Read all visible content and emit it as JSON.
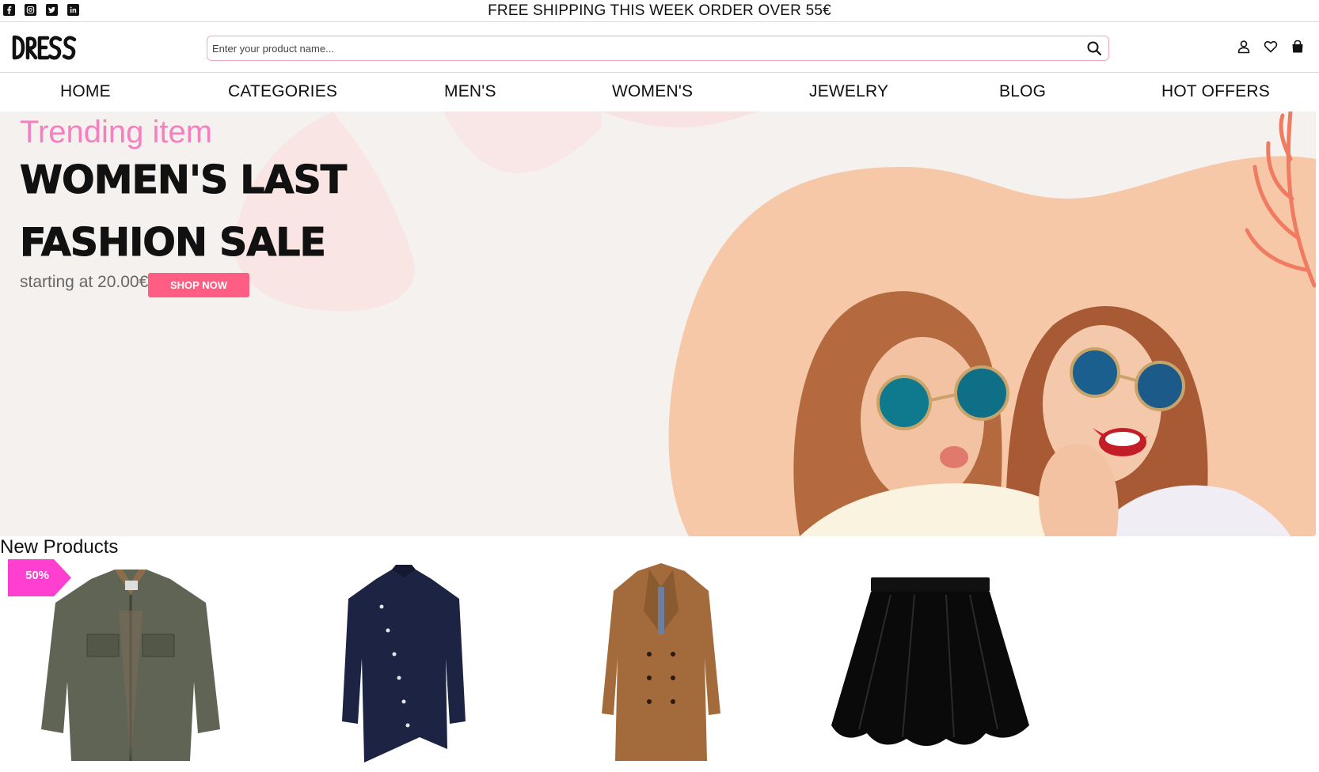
{
  "topbar": {
    "socials": [
      "facebook-icon",
      "instagram-icon",
      "twitter-icon",
      "linkedin-icon"
    ],
    "shipping_text": "FREE SHIPPING THIS WEEK ORDER OVER 55€"
  },
  "header": {
    "logo_text": "DRESS",
    "search_placeholder": "Enter your product name...",
    "icons": [
      "user-icon",
      "heart-icon",
      "bag-icon"
    ]
  },
  "nav": {
    "items": [
      "HOME",
      "CATEGORIES",
      "MEN'S",
      "WOMEN'S",
      "JEWELRY",
      "BLOG",
      "HOT OFFERS"
    ]
  },
  "hero": {
    "kicker": "Trending item",
    "title_line1": "WOMEN'S LAST",
    "title_line2": "FASHION SALE",
    "starting_text": "starting at 20.00€",
    "button_label": "SHOP NOW"
  },
  "new_products": {
    "title": "New Products",
    "badge": "50%",
    "items": [
      "jacket-image",
      "shirt-image",
      "coat-image",
      "skirt-image"
    ]
  },
  "colors": {
    "accent_pink": "#ff5d83",
    "kicker_pink": "#f57fc0",
    "badge_magenta": "#ff3fcf",
    "hero_bg": "#f4f1ee",
    "blob_peach": "#f7c8a8"
  }
}
